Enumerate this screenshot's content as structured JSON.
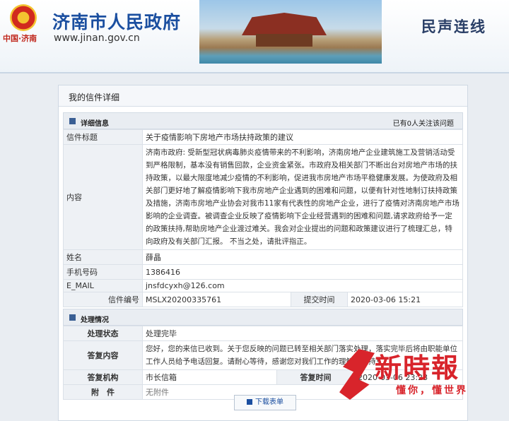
{
  "header": {
    "site_title": "济南市人民政府",
    "site_url": "www.jinan.gov.cn",
    "city_small": "中国·济南",
    "section_name": "民声连线"
  },
  "panel": {
    "tab_label": "我的信件详细"
  },
  "detail": {
    "section_title": "详细信息",
    "follow_count_text": "已有0人关注该问题",
    "letter_title_label": "信件标题",
    "letter_title_value": "关于疫情影响下房地产市场扶持政策的建议",
    "content_label": "内容",
    "content_value": "济南市政府: 受新型冠状病毒肺炎疫情带来的不利影响，济南房地产企业建筑施工及营销活动受到严格限制，基本没有销售回款，企业资金紧张。市政府及相关部门不断出台对房地产市场的扶持政策，以最大限度地减少疫情的不利影响，促进我市房地产市场平稳健康发展。为使政府及相关部门更好地了解疫情影响下我市房地产企业遇到的困难和问题，以便有针对性地制订扶持政策及措施，济南市房地产业协会对我市11家有代表性的房地产企业，进行了疫情对济南房地产市场影响的企业调查。被调查企业反映了疫情影响下企业经营遇到的困难和问题,请求政府给予一定的政策扶持,帮助房地产企业渡过难关。我会对企业提出的问题和政策建议进行了梳理汇总，特向政府及有关部门汇报。 不当之处，请批评指正。",
    "name_label": "姓名",
    "name_value": "薛晶",
    "phone_label": "手机号码",
    "phone_value": "1386416",
    "email_label": "E_MAIL",
    "email_value": "jnsfdcyxh@126.com",
    "letter_no_label": "信件编号",
    "letter_no_value": "MSLX20200335761",
    "submit_time_label": "提交时间",
    "submit_time_value": "2020-03-06 15:21"
  },
  "handling": {
    "section_title": "处理情况",
    "status_label": "处理状态",
    "status_value": "处理完毕",
    "reply_label": "答复内容",
    "reply_value": "您好，您的来信已收到。关于您反映的问题已转至相关部门落实处理，落实完毕后将由职能单位工作人员给予电话回复。请耐心等待，感谢您对我们工作的理解与支持！",
    "org_label": "答复机构",
    "org_value": "市长信箱",
    "reply_time_label": "答复时间",
    "reply_time_value": "2020-03-06 23:23",
    "attach_label": "附　件",
    "attach_value": "无附件"
  },
  "download_button_label": "下载表单",
  "watermark": {
    "name": "新時報",
    "slogan": "懂你，懂世界"
  },
  "colors": {
    "brand_blue": "#1b4fa0",
    "watermark_red": "#d8242b"
  }
}
